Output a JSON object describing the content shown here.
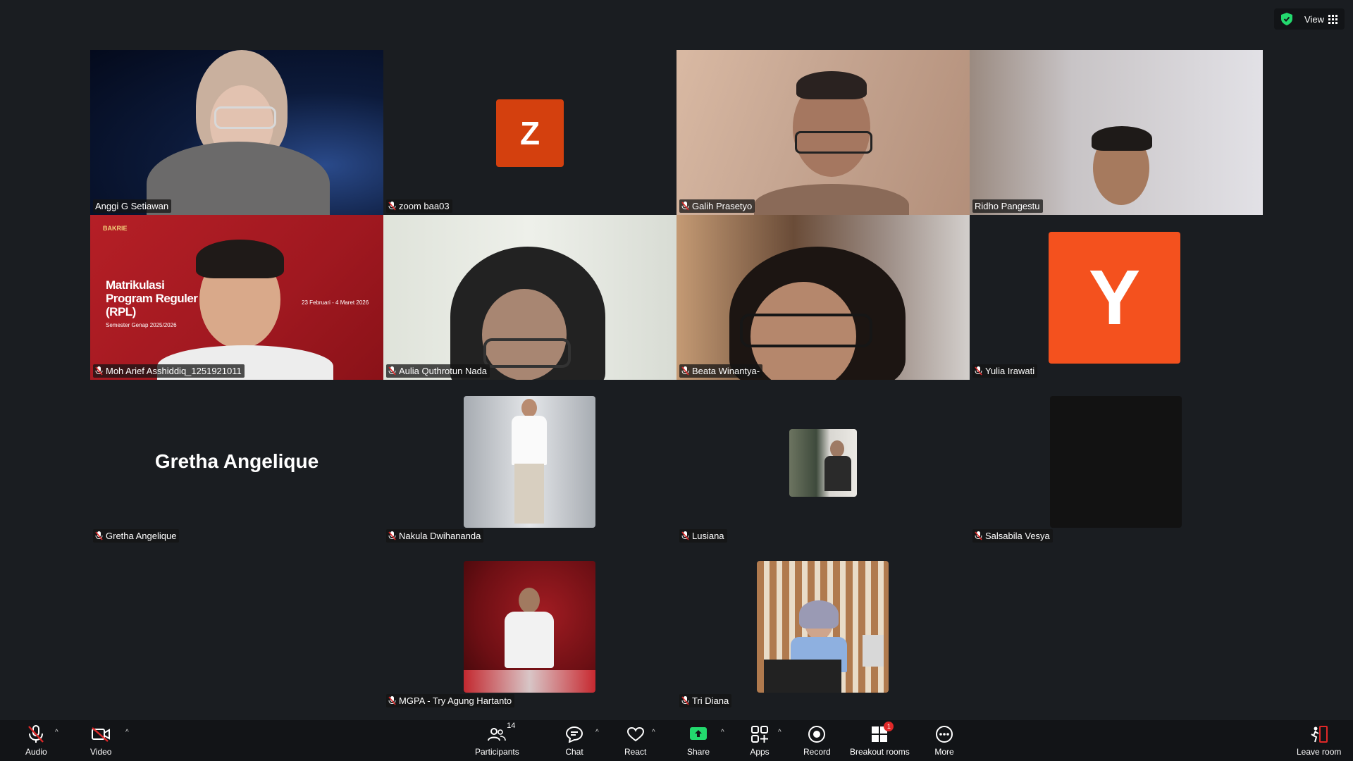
{
  "top": {
    "view_label": "View"
  },
  "participants": {
    "anggi": "Anggi G Setiawan",
    "zoom": "zoom baa03",
    "galih": "Galih Prasetyo",
    "ridho": "Ridho Pangestu",
    "arief": "Moh Arief Asshiddiq_1251921011",
    "aulia": "Aulia Quthrotun Nada",
    "beata": "Beata Winantya-",
    "yulia": "Yulia Irawati",
    "gretha": "Gretha Angelique",
    "nakula": "Nakula Dwihananda",
    "lusiana": "Lusiana",
    "salsabila": "Salsabila Vesya",
    "mgpa": "MGPA - Try Agung Hartanto",
    "tri": "Tri Diana"
  },
  "avatars": {
    "z": "Z",
    "y": "Y"
  },
  "background_slide": {
    "brand": "BAKRIE",
    "title_line1": "Matrikulasi",
    "title_line2": "Program Reguler",
    "title_line3": "(RPL)",
    "semester": "Semester Genap 2025/2026",
    "dates": "23 Februari - 4 Maret 2026"
  },
  "toolbar": {
    "audio": "Audio",
    "video": "Video",
    "participants": "Participants",
    "participants_count": "14",
    "chat": "Chat",
    "react": "React",
    "share": "Share",
    "apps": "Apps",
    "record": "Record",
    "breakout": "Breakout rooms",
    "breakout_badge": "1",
    "more": "More",
    "leave": "Leave room"
  },
  "colors": {
    "active_speaker": "#23d96e",
    "avatar_z": "#d4400e",
    "avatar_y": "#f4511e"
  }
}
